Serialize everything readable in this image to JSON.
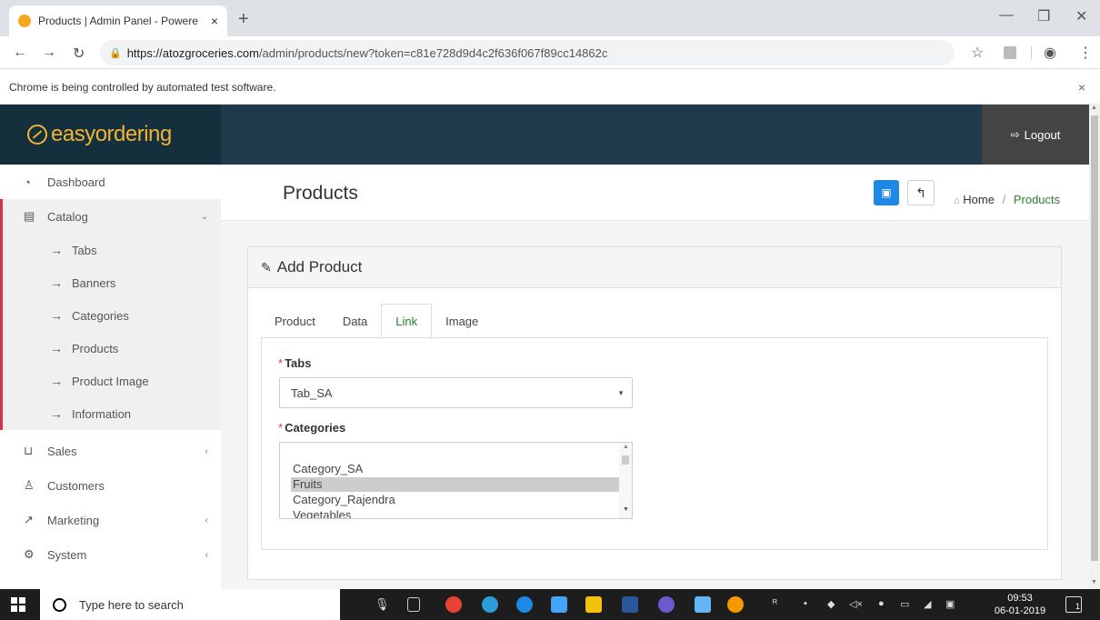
{
  "browser": {
    "tab_title": "Products | Admin Panel - Powere",
    "tab_close": "×",
    "new_tab": "+",
    "url_host": "https://atozgroceries.com",
    "url_path": "/admin/products/new?token=c81e728d9d4c2f636f067f89cc14862c",
    "infobar_text": "Chrome is being controlled by automated test software.",
    "infobar_close": "×"
  },
  "header": {
    "brand": "easyordering",
    "logout_label": "Logout"
  },
  "sidebar": {
    "items": [
      {
        "label": "Dashboard",
        "icon": "dashboard-icon"
      },
      {
        "label": "Catalog",
        "icon": "catalog-icon"
      },
      {
        "label": "Sales",
        "icon": "cart-icon"
      },
      {
        "label": "Customers",
        "icon": "user-icon"
      },
      {
        "label": "Marketing",
        "icon": "share-icon"
      },
      {
        "label": "System",
        "icon": "gear-icon"
      }
    ],
    "catalog_sub": [
      "Tabs",
      "Banners",
      "Categories",
      "Products",
      "Product Image",
      "Information"
    ]
  },
  "page": {
    "title": "Products",
    "breadcrumb_home": "Home",
    "breadcrumb_sep": "/",
    "breadcrumb_current": "Products"
  },
  "panel": {
    "title": "Add Product",
    "tabs": [
      "Product",
      "Data",
      "Link",
      "Image"
    ],
    "active_tab": "Link",
    "tabs_label": "Tabs",
    "tabs_value": "Tab_SA",
    "categories_label": "Categories",
    "categories_options": [
      "Category_SA",
      "Fruits",
      "Category_Rajendra",
      "Vegetables"
    ],
    "categories_selected": "Fruits"
  },
  "taskbar": {
    "search_placeholder": "Type here to search",
    "time": "09:53",
    "date": "06-01-2019",
    "notification_count": "1"
  },
  "colors": {
    "header_bg": "#1f3a4a",
    "brand": "#f2b234",
    "accent_red": "#d9304a",
    "active_green": "#2e7d32",
    "save_blue": "#1e88e5"
  }
}
